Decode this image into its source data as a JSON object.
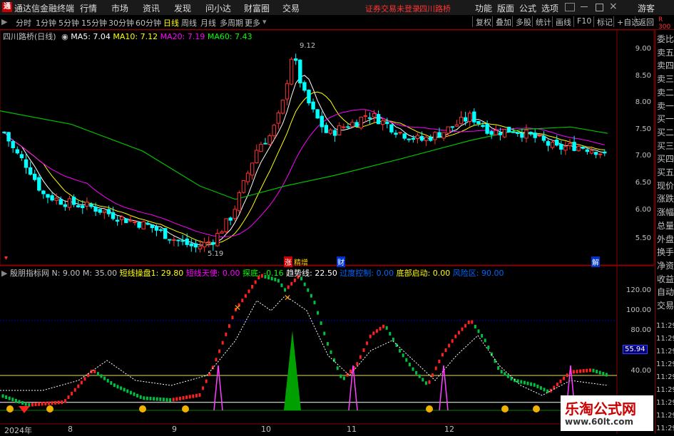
{
  "app": {
    "title": "通达信金融终端",
    "status_text": "证券交易未登录",
    "stock_title": "四川路桥"
  },
  "menu": [
    "行情",
    "市场",
    "资讯",
    "发现",
    "问小达",
    "财富圈",
    "交易"
  ],
  "menu_right": [
    "功能",
    "版面",
    "公式",
    "选项",
    "游客"
  ],
  "periods": [
    "分时",
    "1分钟",
    "5分钟",
    "15分钟",
    "30分钟",
    "60分钟",
    "日线",
    "周线",
    "月线",
    "多周期",
    "更多"
  ],
  "active_period": "日线",
  "toolbar_right": [
    "复权",
    "叠加",
    "多股",
    "统计",
    "画线",
    "F10",
    "标记",
    "+自选",
    "返回"
  ],
  "main_chart": {
    "name": "四川路桥(日线)",
    "ma": [
      {
        "label": "MA5: 7.04",
        "color": "#ffffff"
      },
      {
        "label": "MA10: 7.12",
        "color": "#ffff00"
      },
      {
        "label": "MA20: 7.19",
        "color": "#ff00ff"
      },
      {
        "label": "MA60: 7.43",
        "color": "#00ff00"
      }
    ],
    "high_label": "9.12",
    "low_label": "5.19",
    "markers": [
      "涨",
      "精增",
      "财",
      "解"
    ]
  },
  "indicator": {
    "name": "殷朋指标网",
    "params": [
      {
        "label": "N: 9.00",
        "color": "#c0c0c0"
      },
      {
        "label": "M: 35.00",
        "color": "#c0c0c0"
      },
      {
        "label": "短线操盘1: 29.80",
        "color": "#ffff00"
      },
      {
        "label": "短线天使: 0.00",
        "color": "#ff00ff"
      },
      {
        "label": "探底: -0.16",
        "color": "#00ff00"
      },
      {
        "label": "趋势线: 22.50",
        "color": "#ffffff"
      },
      {
        "label": "过度控制: 0.00",
        "color": "#0066ff"
      },
      {
        "label": "底部启动: 0.00",
        "color": "#ffff00"
      },
      {
        "label": "风险区: 90.00",
        "color": "#0066ff"
      }
    ],
    "current_value": "55.94"
  },
  "x_axis": [
    "2024年",
    "8",
    "9",
    "10",
    "11",
    "12"
  ],
  "price_ticks": [
    "9.00",
    "8.50",
    "8.00",
    "7.50",
    "7.00",
    "6.50",
    "6.00",
    "5.50"
  ],
  "indicator_ticks": [
    "120.00",
    "100.00",
    "80.00",
    "40.00"
  ],
  "right_panel": {
    "top": "R 300",
    "items": [
      "委比",
      "卖五",
      "卖四",
      "卖三",
      "卖二",
      "卖一",
      "买一",
      "买二",
      "买三",
      "买四",
      "买五",
      "现价",
      "涨跌",
      "涨幅",
      "总量",
      "外盘",
      "换手",
      "净资",
      "收益",
      "自动",
      "交易"
    ],
    "times": [
      "11:29",
      "11:29",
      "11:29",
      "11:29",
      "11:29",
      "11:29",
      "11:29",
      "11:29",
      "11:29"
    ]
  },
  "watermark": {
    "line1": "乐淘公式网",
    "line2": "www.60lt.com"
  }
}
